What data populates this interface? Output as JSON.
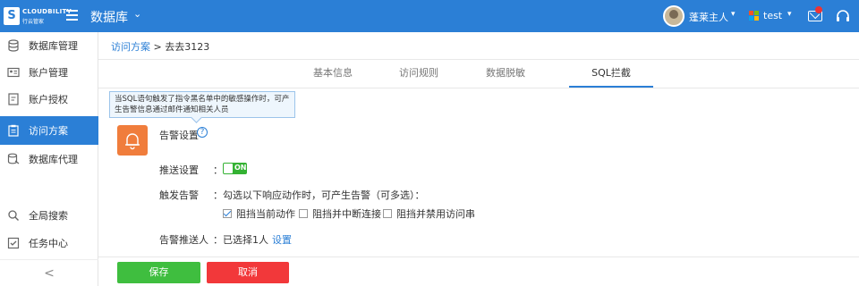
{
  "header": {
    "logo_text": "CLOUDBILITY",
    "logo_sub": "行云管家",
    "app_title": "数据库",
    "user_name": "蓬莱主人",
    "tenant_name": "test"
  },
  "sidebar": {
    "items": [
      {
        "label": "数据库管理",
        "icon": "database-icon"
      },
      {
        "label": "账户管理",
        "icon": "id-card-icon"
      },
      {
        "label": "账户授权",
        "icon": "auth-doc-icon"
      },
      {
        "label": "访问方案",
        "icon": "clipboard-icon",
        "active": true
      },
      {
        "label": "数据库代理",
        "icon": "database-proxy-icon"
      }
    ],
    "bottom_items": [
      {
        "label": "全局搜索",
        "icon": "search-icon"
      },
      {
        "label": "任务中心",
        "icon": "task-icon"
      }
    ],
    "collapse_glyph": "<"
  },
  "breadcrumb": {
    "parent": "访问方案",
    "separator": " > ",
    "current": "去去3123"
  },
  "tabs": [
    {
      "label": "基本信息"
    },
    {
      "label": "访问规则"
    },
    {
      "label": "数据脱敏"
    },
    {
      "label": "SQL拦截",
      "active": true
    }
  ],
  "tooltip": {
    "text": "当SQL语句触发了指令黑名单中的敏感操作时，可产生告警信息通过邮件通知相关人员"
  },
  "alert": {
    "title": "告警设置",
    "help_glyph": "?",
    "push_label": "推送设置",
    "push_toggle_text": "ON",
    "push_enabled": true,
    "trigger_label": "触发告警",
    "trigger_desc": "勾选以下响应动作时，可产生告警（可多选）：",
    "options": [
      {
        "label": "阻挡当前动作",
        "checked": true
      },
      {
        "label": "阻挡并中断连接",
        "checked": false
      },
      {
        "label": "阻挡并禁用访问串",
        "checked": false
      }
    ],
    "recipient_label": "告警推送人",
    "recipient_value": "已选择1人",
    "recipient_link": "设置",
    "colon": "："
  },
  "footer": {
    "save_label": "保存",
    "cancel_label": "取消"
  },
  "colors": {
    "primary": "#2b7fd6",
    "save": "#3fbe3f",
    "cancel": "#f2383a",
    "bell": "#f07d3c",
    "toggle_on": "#34b233"
  }
}
